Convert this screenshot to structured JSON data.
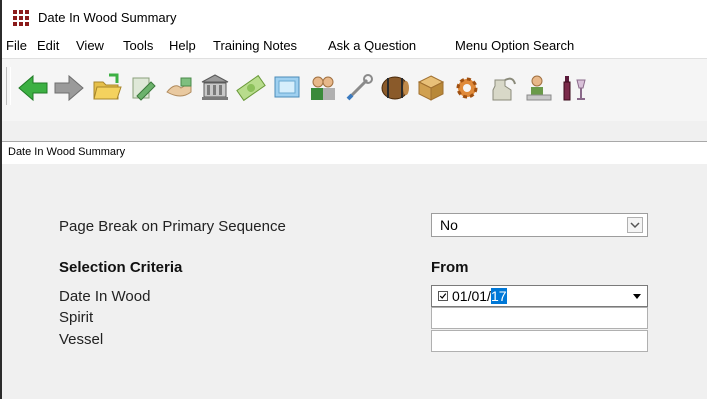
{
  "window": {
    "title": "Date In Wood Summary",
    "app_icon": "grid-app-icon"
  },
  "menu": [
    "File",
    "Edit",
    "View",
    "Tools",
    "Help",
    "Training Notes",
    "Ask a Question",
    "Menu Option Search"
  ],
  "toolbar": {
    "buttons": [
      {
        "name": "back-arrow-icon"
      },
      {
        "name": "forward-arrow-icon"
      },
      {
        "name": "open-folder-icon"
      },
      {
        "name": "notes-icon"
      },
      {
        "name": "handshake-icon"
      },
      {
        "name": "bank-icon"
      },
      {
        "name": "money-icon"
      },
      {
        "name": "screen-icon"
      },
      {
        "name": "people-icon"
      },
      {
        "name": "wrench-icon"
      },
      {
        "name": "barrel-icon"
      },
      {
        "name": "box-icon"
      },
      {
        "name": "gear-icon"
      },
      {
        "name": "still-icon"
      },
      {
        "name": "worker-icon"
      },
      {
        "name": "wine-bottle-icon"
      }
    ]
  },
  "tab": {
    "label": "Date In Wood Summary"
  },
  "form": {
    "page_break_label": "Page Break on Primary Sequence",
    "page_break_value": "No",
    "selection_criteria_heading": "Selection Criteria",
    "from_heading": "From",
    "date_in_wood_label": "Date In Wood",
    "date_in_wood_value_prefix": "01/01/",
    "date_in_wood_value_selected": "17",
    "date_in_wood_checked": true,
    "spirit_label": "Spirit",
    "spirit_value": "",
    "vessel_label": "Vessel",
    "vessel_value": ""
  },
  "colors": {
    "selection": "#0078d7",
    "app_icon": "#8b1a1a"
  }
}
